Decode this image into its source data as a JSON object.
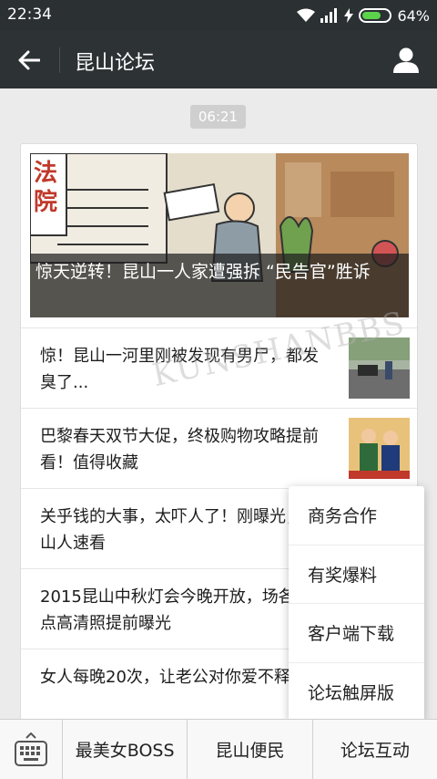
{
  "status": {
    "time": "22:34",
    "battery": "64%"
  },
  "header": {
    "title": "昆山论坛"
  },
  "timestamp": "06:21",
  "hero": {
    "caption": "惊天逆转！昆山一人家遭强拆 “民告官”胜诉"
  },
  "articles": [
    {
      "title": "惊！昆山一河里刚被发现有男尸，都发臭了..."
    },
    {
      "title": "巴黎春天双节大促，终极购物攻略提前看！值得收藏"
    },
    {
      "title": "关乎钱的大事，太吓人了！刚曝光，昆山人速看"
    },
    {
      "title": "2015昆山中秋灯会今晚开放，场各布景点高清照提前曝光"
    },
    {
      "title": "女人每晚20次，让老公对你爱不释手！"
    }
  ],
  "popup_menu": [
    "商务合作",
    "有奖爆料",
    "客户端下载",
    "论坛触屏版"
  ],
  "bottom_tabs": [
    "最美女BOSS",
    "昆山便民",
    "论坛互动"
  ],
  "watermark": "KUNSHANBBS"
}
